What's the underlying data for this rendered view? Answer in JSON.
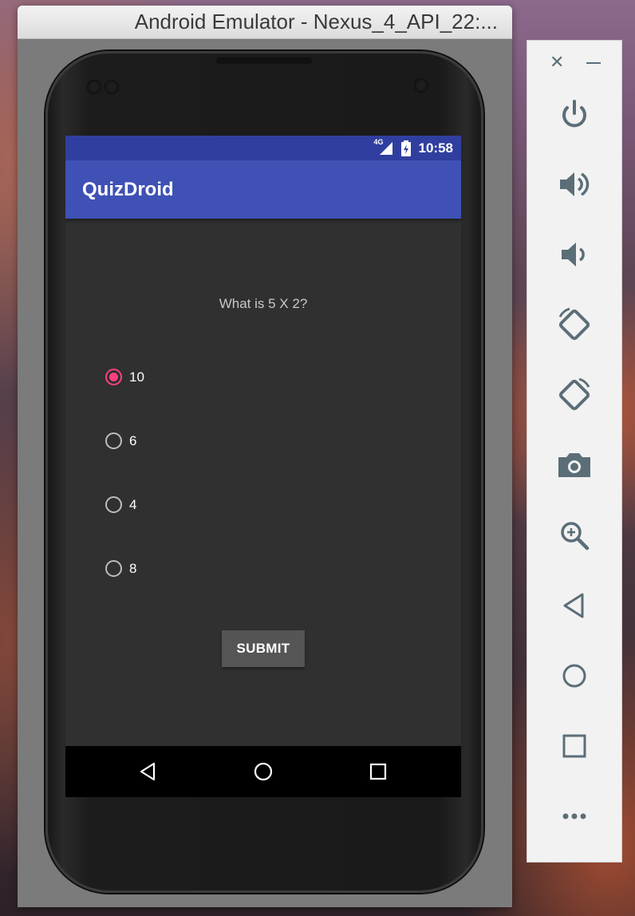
{
  "emulator": {
    "window_title": "Android Emulator - Nexus_4_API_22:..."
  },
  "status_bar": {
    "network": "4G",
    "time": "10:58"
  },
  "app": {
    "title": "QuizDroid",
    "question": "What is 5 X 2?",
    "options": [
      {
        "label": "10",
        "selected": true
      },
      {
        "label": "6",
        "selected": false
      },
      {
        "label": "4",
        "selected": false
      },
      {
        "label": "8",
        "selected": false
      }
    ],
    "submit_label": "SUBMIT"
  },
  "colors": {
    "status_bar": "#303f9f",
    "app_bar": "#3f51b5",
    "accent": "#ff4081",
    "screen_bg": "#303030",
    "side_icon": "#5b6e78"
  },
  "navigation": [
    "back-icon",
    "home-icon",
    "recents-icon"
  ],
  "side_panel": {
    "window_controls": [
      "close-icon",
      "minimize-icon"
    ],
    "buttons": [
      "power-icon",
      "volume-up-icon",
      "volume-down-icon",
      "rotate-left-icon",
      "rotate-right-icon",
      "camera-icon",
      "zoom-icon",
      "back-icon",
      "home-icon",
      "overview-icon",
      "more-icon"
    ]
  }
}
